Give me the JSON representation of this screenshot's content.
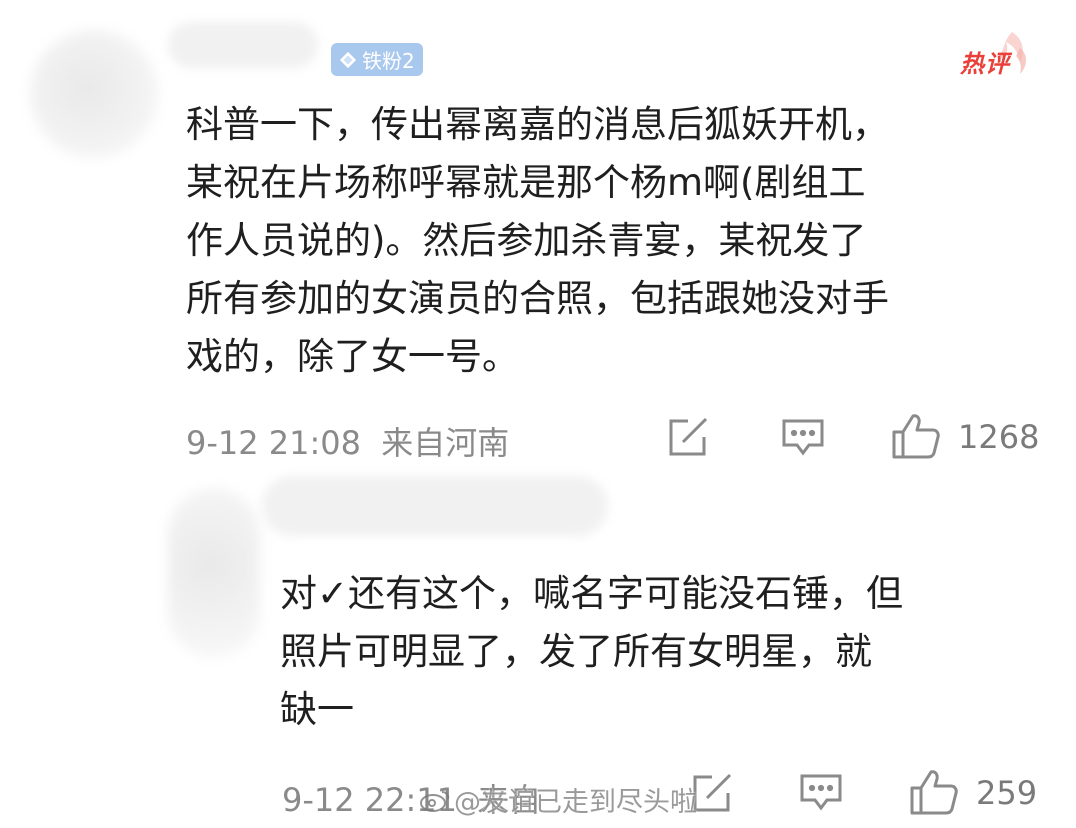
{
  "comment1": {
    "badge_label": "铁粉2",
    "hot_label": "热评",
    "lines": [
      "科普一下，传出幂离嘉的消息后狐妖开机，",
      "某祝在片场称呼幂就是那个杨m啊(剧组工",
      "作人员说的)。然后参加杀青宴，某祝发了",
      "所有参加的女演员的合照，包括跟她没对手",
      "戏的，除了女一号。"
    ],
    "time": "9-12 21:08",
    "location": "来自河南",
    "like_count": "1268"
  },
  "comment2": {
    "lines": [
      "对✓还有这个，喊名字可能没石锤，但",
      "照片可明显了，发了所有女明星，就",
      "缺一"
    ],
    "time": "9-12 22:11",
    "location": "来自",
    "like_count": "259"
  },
  "watermark": {
    "text": "@友谊已走到尽头啦"
  },
  "colors": {
    "badge_bg": "#a9c8ee",
    "hot_red": "#e9403a",
    "meta_gray": "#8a8a8a"
  }
}
